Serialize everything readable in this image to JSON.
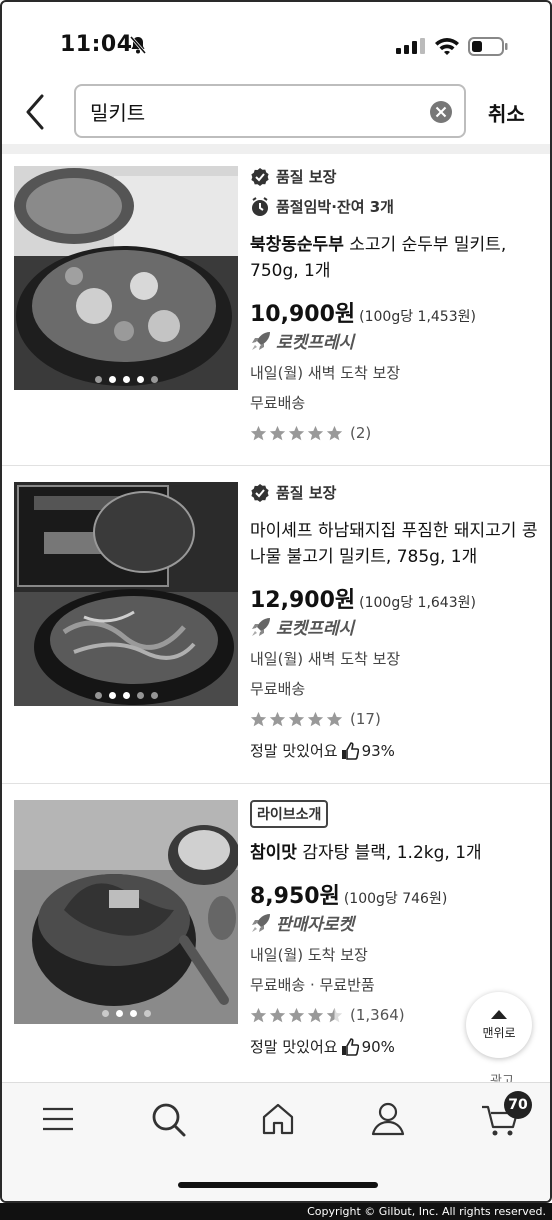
{
  "status_bar": {
    "time": "11:04"
  },
  "search": {
    "query": "밀키트",
    "cancel_label": "취소"
  },
  "products": [
    {
      "badge": "품질 보장",
      "stock_note": "품절임박·잔여 3개",
      "brand": "북창동순두부",
      "name": " 소고기 순두부 밀키트, 750g, 1개",
      "price": "10,900원",
      "unit_price": "(100g당 1,453원)",
      "delivery_type": "로켓프레시",
      "arrival": "내일(월) 새벽 도착 보장",
      "shipping": "무료배송",
      "rating": 5,
      "review_count": "(2)"
    },
    {
      "badge": "품질 보장",
      "brand": "",
      "name": "마이셰프 하남돼지집 푸짐한 돼지고기 콩나물 불고기 밀키트, 785g, 1개",
      "price": "12,900원",
      "unit_price": "(100g당 1,643원)",
      "delivery_type": "로켓프레시",
      "arrival": "내일(월) 새벽 도착 보장",
      "shipping": "무료배송",
      "rating": 5,
      "review_count": "(17)",
      "tasty": "정말 맛있어요",
      "tasty_pct": "93%"
    },
    {
      "tag": "라이브소개",
      "brand": "참이맛",
      "name": " 감자탕 블랙, 1.2kg, 1개",
      "price": "8,950원",
      "unit_price": "(100g당 746원)",
      "delivery_type": "판매자로켓",
      "arrival": "내일(월) 도착 보장",
      "shipping": "무료배송 · 무료반품",
      "rating": 4.5,
      "review_count": "(1,364)",
      "tasty": "정말 맛있어요",
      "tasty_pct": "90%"
    }
  ],
  "top_button_label": "맨위로",
  "ad_label": "광고",
  "bottom_nav": {
    "items": [
      "menu-icon",
      "search-icon",
      "home-icon",
      "user-icon",
      "cart-icon"
    ],
    "cart_count": "70"
  },
  "copyright": "Copyright © Gilbut, Inc. All rights reserved."
}
